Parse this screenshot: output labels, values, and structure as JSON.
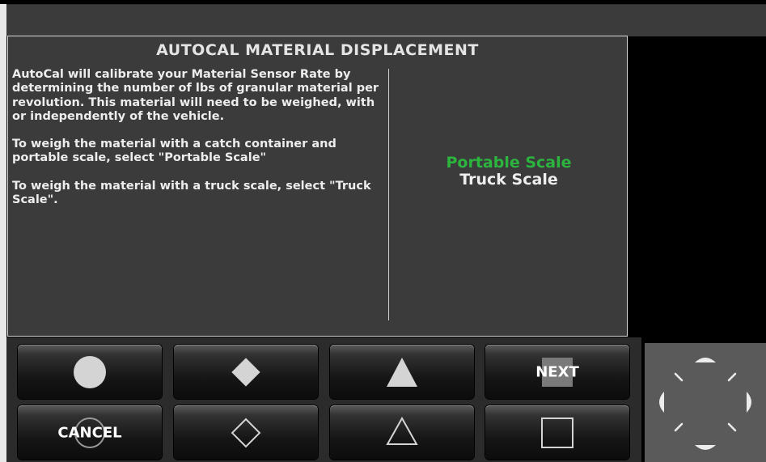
{
  "dialog": {
    "title": "AUTOCAL MATERIAL DISPLACEMENT",
    "paragraphs": [
      "AutoCal will calibrate your Material Sensor Rate by determining the number of lbs of granular material per revolution. This material will need to be weighed, with or independently of the vehicle.",
      "To weigh the material with a catch container and portable scale, select \"Portable Scale\"",
      "To weigh the material with a truck scale, select \"Truck Scale\"."
    ],
    "options": [
      {
        "label": "Portable Scale",
        "selected": true
      },
      {
        "label": "Truck Scale",
        "selected": false
      }
    ]
  },
  "softkeys": {
    "next_label": "NEXT",
    "cancel_label": "CANCEL"
  },
  "colors": {
    "selected_option": "#2bb53f",
    "panel_bg": "#3b3b3b",
    "dpad_bg": "#5a5a5a"
  },
  "icons": [
    "circle-icon",
    "diamond-icon",
    "triangle-icon",
    "square-icon",
    "circle-outline-icon",
    "diamond-outline-icon",
    "triangle-outline-icon",
    "square-outline-icon",
    "dpad-up-icon",
    "dpad-down-icon",
    "dpad-left-icon",
    "dpad-right-icon"
  ]
}
